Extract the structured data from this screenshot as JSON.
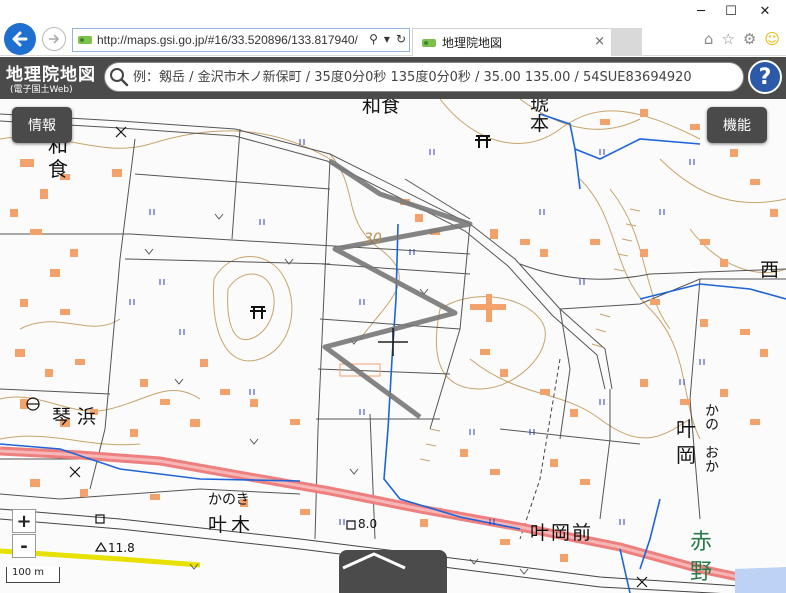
{
  "browser": {
    "url": "http://maps.gsi.go.jp/#16/33.520896/133.817940/",
    "tab_title": "地理院地図",
    "tab_close": "×",
    "minimize": "─",
    "maximize": "☐",
    "close": "✕"
  },
  "header": {
    "logo_main": "地理院地図",
    "logo_sub": "(電子国土Web)",
    "search_placeholder": "例：剱岳 / 金沢市木ノ新保町 / 35度0分0秒 135度0分0秒 / 35.00 135.00 / 54SUE83694920",
    "help_label": "?"
  },
  "map_controls": {
    "info_label": "情報",
    "function_label": "機能",
    "zoom_in": "+",
    "zoom_out": "-",
    "scale_label": "100 m"
  },
  "map_labels": {
    "place_top": "和食",
    "place_left_1": "和",
    "place_left_2": "食",
    "place_top_right_1": "琥",
    "place_top_right_2": "本",
    "place_right_edge": "西",
    "place_kotohama": "琴浜",
    "place_kanooka_kanji_1": "叶",
    "place_kanooka_kanji_2": "岡",
    "place_kanooka_kana_1": "かの",
    "place_kanooka_kana_2": "おか",
    "place_kanoki_kana": "かのき",
    "place_kanoki": "叶木",
    "place_kanooka_mae": "叶岡前",
    "place_akano_1": "赤",
    "place_akano_2": "野",
    "contour_label": "30",
    "elev_1": "8.0",
    "elev_2": "11.8"
  },
  "colors": {
    "header_bg": "#4b4b4b",
    "help_btn": "#2c5aa8",
    "back_btn": "#1e6fd0",
    "road_main": "#ee7f7f",
    "river": "#1e64d8",
    "contour": "#c8a46b",
    "building": "#f3a26b",
    "farmland": "#2f3fc0",
    "path_overlay": "#777777"
  }
}
